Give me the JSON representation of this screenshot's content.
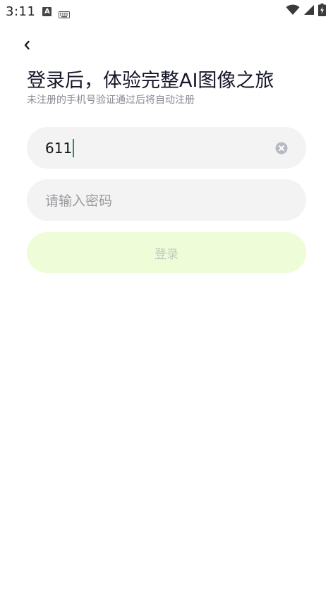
{
  "status_bar": {
    "time": "3:11",
    "notification_icons": [
      "a-icon",
      "keyboard-icon"
    ],
    "system_icons": [
      "wifi-icon",
      "signal-icon",
      "battery-charging-icon"
    ]
  },
  "header": {
    "back_icon": "chevron-left-icon",
    "title": "登录后，体验完整AI图像之旅",
    "subtitle": "未注册的手机号验证通过后将自动注册"
  },
  "form": {
    "phone": {
      "value": "611",
      "clear_icon": "clear-circle-icon"
    },
    "password": {
      "placeholder": "请输入密码"
    },
    "login_label": "登录"
  },
  "colors": {
    "login_button_bg": "#eefcd7",
    "login_button_text": "#c4c9c0",
    "caret": "#1a8f7e",
    "field_bg": "#f3f3f3",
    "title_text": "#15162a",
    "subtitle_text": "#8a8a93"
  }
}
